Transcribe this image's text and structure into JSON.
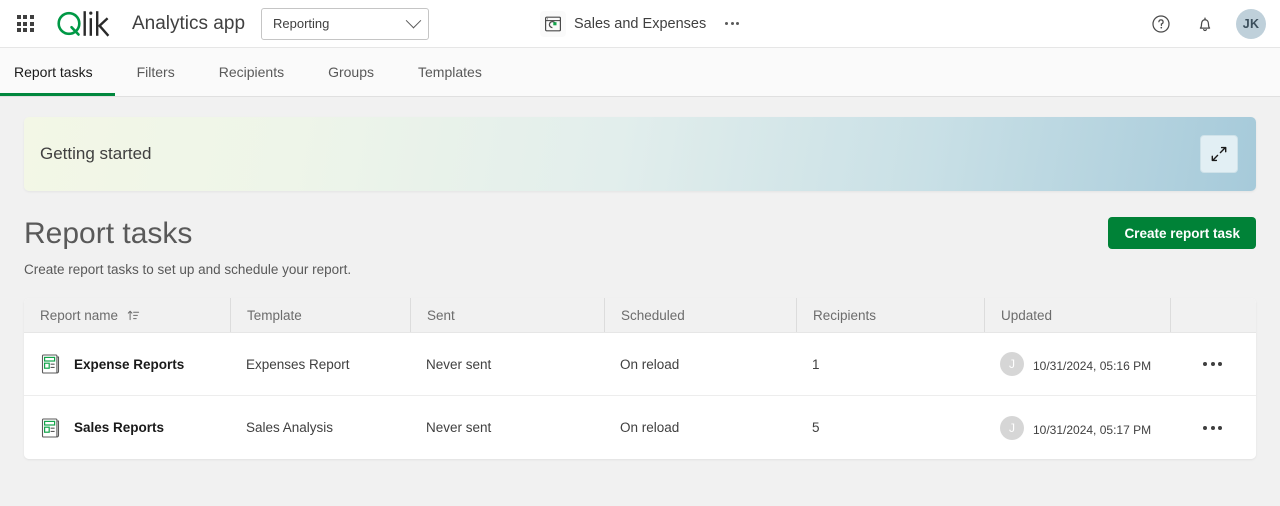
{
  "topbar": {
    "launcher_label": "App launcher",
    "brand": "Qlik",
    "app_title": "Analytics app",
    "space": {
      "value": "Reporting",
      "placeholder": "Select space"
    },
    "current_app": "Sales and Expenses",
    "app_more_label": "More options",
    "help_label": "Help",
    "notifications_label": "Notifications",
    "avatar_initials": "JK"
  },
  "tabs": [
    {
      "label": "Report tasks",
      "active": true
    },
    {
      "label": "Filters",
      "active": false
    },
    {
      "label": "Recipients",
      "active": false
    },
    {
      "label": "Groups",
      "active": false
    },
    {
      "label": "Templates",
      "active": false
    }
  ],
  "banner": {
    "title": "Getting started",
    "expand_label": "Expand"
  },
  "page": {
    "title": "Report tasks",
    "subtitle": "Create report tasks to set up and schedule your report.",
    "create_button": "Create report task"
  },
  "table": {
    "columns": [
      {
        "label": "Report name",
        "sorted": true
      },
      {
        "label": "Template",
        "sorted": false
      },
      {
        "label": "Sent",
        "sorted": false
      },
      {
        "label": "Scheduled",
        "sorted": false
      },
      {
        "label": "Recipients",
        "sorted": false
      },
      {
        "label": "Updated",
        "sorted": false
      },
      {
        "label": "",
        "sorted": false
      }
    ],
    "rows": [
      {
        "name": "Expense Reports",
        "template": "Expenses Report",
        "sent": "Never sent",
        "scheduled": "On reload",
        "recipients": "1",
        "updated_by_initial": "J",
        "updated_by_name": "",
        "updated_time": "10/31/2024, 05:16 PM"
      },
      {
        "name": "Sales Reports",
        "template": "Sales Analysis",
        "sent": "Never sent",
        "scheduled": "On reload",
        "recipients": "5",
        "updated_by_initial": "J",
        "updated_by_name": "",
        "updated_time": "10/31/2024, 05:17 PM"
      }
    ]
  },
  "colors": {
    "brand_green": "#00873d",
    "button_green": "#008237",
    "banner_left": "#f3f7e6",
    "banner_right": "#a6cada",
    "avatar_bg": "#bfd0da"
  }
}
